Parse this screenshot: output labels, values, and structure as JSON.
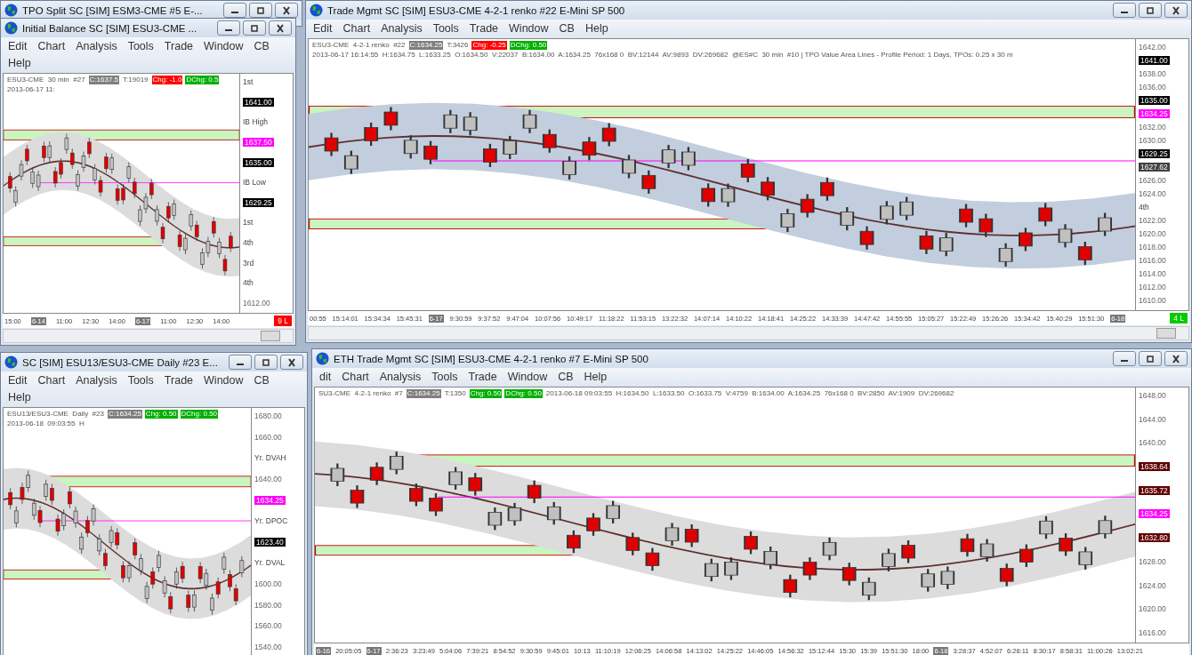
{
  "windows": [
    {
      "kind": "stub",
      "title": "TPO Split  SC [SIM] ESM3-CME  #5  E-..."
    },
    {
      "kind": "chart",
      "title": "Initial Balance  SC [SIM] ESU3-CME  ...",
      "menu": [
        "Edit",
        "Chart",
        "Analysis",
        "Tools",
        "Trade",
        "Window",
        "CB",
        "Help"
      ],
      "info": [
        {
          "text": "ESU3-CME  30 min  #27"
        },
        {
          "text": "C:1637.5",
          "color": "#7f7f7f"
        },
        {
          "text": "T:19019"
        },
        {
          "text": "Chg: -1.0",
          "color": "#ff0000"
        },
        {
          "text": "DChg: 0.5",
          "color": "#00b000"
        },
        {
          "text": "2013-06-17 11:"
        }
      ],
      "axis": [
        {
          "kind": "note",
          "text": "1st"
        },
        {
          "kind": "marker",
          "text": "1641.00",
          "color": "#000000"
        },
        {
          "kind": "note",
          "text": "IB High"
        },
        {
          "kind": "marker",
          "text": "1637.50",
          "color": "#ff00ff"
        },
        {
          "kind": "marker",
          "text": "1635.00",
          "color": "#000000"
        },
        {
          "kind": "note",
          "text": "IB Low"
        },
        {
          "kind": "marker",
          "text": "1629.25",
          "color": "#000000"
        },
        {
          "kind": "note",
          "text": "1st"
        },
        {
          "kind": "note",
          "text": "4th"
        },
        {
          "kind": "note",
          "text": "3rd"
        },
        {
          "kind": "note",
          "text": "4th"
        },
        {
          "kind": "tick",
          "text": "1612.00"
        }
      ],
      "times": [
        {
          "text": "15:00",
          "date": false
        },
        {
          "text": "6-14",
          "date": true
        },
        {
          "text": "11:00",
          "date": false
        },
        {
          "text": "12:30",
          "date": false
        },
        {
          "text": "14:00",
          "date": false
        },
        {
          "text": "6-17",
          "date": true
        },
        {
          "text": "11:00",
          "date": false
        },
        {
          "text": "12:30",
          "date": false
        },
        {
          "text": "14:00",
          "date": false
        }
      ],
      "status": {
        "text": "9 L",
        "color": "#ff0000"
      }
    },
    {
      "kind": "chart",
      "title": "Trade Mgmt  SC [SIM] ESU3-CME  4-2-1 renko  #22  E-Mini SP 500",
      "menu": [
        "Edit",
        "Chart",
        "Analysis",
        "Tools",
        "Trade",
        "Window",
        "CB",
        "Help"
      ],
      "info": [
        {
          "text": "ESU3-CME  4-2-1 renko  #22"
        },
        {
          "text": "C:1634.25",
          "color": "#7f7f7f"
        },
        {
          "text": "T:3426"
        },
        {
          "text": "Chg: -0.25",
          "color": "#ff0000"
        },
        {
          "text": "DChg: 0.50",
          "color": "#00b000"
        },
        {
          "text": "2013-06-17 16:14:55  H:1634.75  L:1633.25  O:1634.50  V:22037  B:1634.00  A:1634.25  76x168 0  BV:12144  AV:9893  DV:269682  @ES#C  30 min  #10 | TPO Value Area Lines - Profile Period: 1 Days, TPOs: 0.25 x 30 m"
        }
      ],
      "axis": [
        {
          "kind": "tick",
          "text": "1642.00"
        },
        {
          "kind": "marker",
          "text": "1641.00",
          "color": "#000000"
        },
        {
          "kind": "tick",
          "text": "1638.00"
        },
        {
          "kind": "tick",
          "text": "1636.00"
        },
        {
          "kind": "marker",
          "text": "1635.00",
          "color": "#000000"
        },
        {
          "kind": "marker",
          "text": "1634.25",
          "color": "#ff00ff"
        },
        {
          "kind": "tick",
          "text": "1632.00"
        },
        {
          "kind": "tick",
          "text": "1630.00"
        },
        {
          "kind": "marker",
          "text": "1629.25",
          "color": "#000000"
        },
        {
          "kind": "marker",
          "text": "1627.62",
          "color": "#404040"
        },
        {
          "kind": "tick",
          "text": "1626.00"
        },
        {
          "kind": "tick",
          "text": "1624.00"
        },
        {
          "kind": "note",
          "text": "4th"
        },
        {
          "kind": "tick",
          "text": "1622.00"
        },
        {
          "kind": "tick",
          "text": "1620.00"
        },
        {
          "kind": "tick",
          "text": "1618.00"
        },
        {
          "kind": "tick",
          "text": "1616.00"
        },
        {
          "kind": "tick",
          "text": "1614.00"
        },
        {
          "kind": "tick",
          "text": "1612.00"
        },
        {
          "kind": "tick",
          "text": "1610.00"
        }
      ],
      "times": [
        {
          "text": "00:55",
          "date": false
        },
        {
          "text": "15:14:01",
          "date": false
        },
        {
          "text": "15:34:34",
          "date": false
        },
        {
          "text": "15:45:31",
          "date": false
        },
        {
          "text": "6-17",
          "date": true
        },
        {
          "text": "9:30:59",
          "date": false
        },
        {
          "text": "9:37:52",
          "date": false
        },
        {
          "text": "9:47:04",
          "date": false
        },
        {
          "text": "10:07:56",
          "date": false
        },
        {
          "text": "10:49:17",
          "date": false
        },
        {
          "text": "11:18:22",
          "date": false
        },
        {
          "text": "11:53:15",
          "date": false
        },
        {
          "text": "13:22:32",
          "date": false
        },
        {
          "text": "14:07:14",
          "date": false
        },
        {
          "text": "14:10:22",
          "date": false
        },
        {
          "text": "14:18:41",
          "date": false
        },
        {
          "text": "14:25:22",
          "date": false
        },
        {
          "text": "14:33:39",
          "date": false
        },
        {
          "text": "14:47:42",
          "date": false
        },
        {
          "text": "14:55:55",
          "date": false
        },
        {
          "text": "15:05:27",
          "date": false
        },
        {
          "text": "15:22:49",
          "date": false
        },
        {
          "text": "15:26:26",
          "date": false
        },
        {
          "text": "15:34:42",
          "date": false
        },
        {
          "text": "15:40:29",
          "date": false
        },
        {
          "text": "15:51:30",
          "date": false
        },
        {
          "text": "6-18",
          "date": true
        }
      ],
      "status": {
        "text": "4 L",
        "color": "#00cc00"
      }
    },
    {
      "kind": "chart",
      "title": "SC [SIM] ESU13/ESU3-CME  Daily  #23  E...",
      "menu": [
        "Edit",
        "Chart",
        "Analysis",
        "Tools",
        "Trade",
        "Window",
        "CB",
        "Help"
      ],
      "info": [
        {
          "text": "ESU13/ESU3-CME  Daily  #23"
        },
        {
          "text": "C:1634.25",
          "color": "#7f7f7f"
        },
        {
          "text": "Chg: 0.50",
          "color": "#00b000"
        },
        {
          "text": "DChg: 0.50",
          "color": "#00b000"
        },
        {
          "text": "2013-06-18  09:03:55  H"
        }
      ],
      "axis": [
        {
          "kind": "tick",
          "text": "1680.00"
        },
        {
          "kind": "tick",
          "text": "1660.00"
        },
        {
          "kind": "note",
          "text": "Yr. DVAH"
        },
        {
          "kind": "tick",
          "text": "1640.00"
        },
        {
          "kind": "marker",
          "text": "1634.25",
          "color": "#ff00ff"
        },
        {
          "kind": "note",
          "text": "Yr. DPOC"
        },
        {
          "kind": "marker",
          "text": "1623.40",
          "color": "#000000"
        },
        {
          "kind": "note",
          "text": "Yr. DVAL"
        },
        {
          "kind": "tick",
          "text": "1600.00"
        },
        {
          "kind": "tick",
          "text": "1580.00"
        },
        {
          "kind": "tick",
          "text": "1560.00"
        },
        {
          "kind": "tick",
          "text": "1540.00"
        }
      ]
    },
    {
      "kind": "chart",
      "title": "ETH Trade Mgmt  SC [SIM] ESU3-CME  4-2-1 renko  #7  E-Mini SP 500",
      "menu": [
        "dit",
        "Chart",
        "Analysis",
        "Tools",
        "Trade",
        "Window",
        "CB",
        "Help"
      ],
      "info": [
        {
          "text": "SU3-CME  4-2-1 renko  #7"
        },
        {
          "text": "C:1634.25",
          "color": "#7f7f7f"
        },
        {
          "text": "T:1350"
        },
        {
          "text": "Chg: 0.50",
          "color": "#00b000"
        },
        {
          "text": "DChg: 0.50",
          "color": "#00b000"
        },
        {
          "text": "2013-06-18 09:03:55  H:1634.50  L:1633.50  O:1633.75  V:4759  B:1634.00  A:1634.25  76x168 0  BV:2850  AV:1909  DV:269682"
        }
      ],
      "axis": [
        {
          "kind": "tick",
          "text": "1648.00"
        },
        {
          "kind": "tick",
          "text": "1644.00"
        },
        {
          "kind": "tick",
          "text": "1640.00"
        },
        {
          "kind": "marker",
          "text": "1638.64",
          "color": "#600000"
        },
        {
          "kind": "marker",
          "text": "1635.72",
          "color": "#600000"
        },
        {
          "kind": "marker",
          "text": "1634.25",
          "color": "#ff00ff"
        },
        {
          "kind": "marker",
          "text": "1632.80",
          "color": "#600000"
        },
        {
          "kind": "tick",
          "text": "1628.00"
        },
        {
          "kind": "tick",
          "text": "1624.00"
        },
        {
          "kind": "tick",
          "text": "1620.00"
        },
        {
          "kind": "tick",
          "text": "1616.00"
        }
      ],
      "times": [
        {
          "text": "6-16",
          "date": true
        },
        {
          "text": "20:05:05",
          "date": false
        },
        {
          "text": "6-17",
          "date": true
        },
        {
          "text": "2:36:23",
          "date": false
        },
        {
          "text": "3:23:49",
          "date": false
        },
        {
          "text": "5:04:06",
          "date": false
        },
        {
          "text": "7:39:21",
          "date": false
        },
        {
          "text": "8:54:52",
          "date": false
        },
        {
          "text": "9:30:59",
          "date": false
        },
        {
          "text": "9:45:01",
          "date": false
        },
        {
          "text": "10:13",
          "date": false
        },
        {
          "text": "11:10:19",
          "date": false
        },
        {
          "text": "12:06:25",
          "date": false
        },
        {
          "text": "14:06:58",
          "date": false
        },
        {
          "text": "14:13:02",
          "date": false
        },
        {
          "text": "14:25:22",
          "date": false
        },
        {
          "text": "14:46:05",
          "date": false
        },
        {
          "text": "14:56:32",
          "date": false
        },
        {
          "text": "15:12:44",
          "date": false
        },
        {
          "text": "15:30",
          "date": false
        },
        {
          "text": "15:39",
          "date": false
        },
        {
          "text": "15:51:30",
          "date": false
        },
        {
          "text": "18:00",
          "date": false
        },
        {
          "text": "6-18",
          "date": true
        },
        {
          "text": "3:28:37",
          "date": false
        },
        {
          "text": "4:52:07",
          "date": false
        },
        {
          "text": "6:26:11",
          "date": false
        },
        {
          "text": "8:30:17",
          "date": false
        },
        {
          "text": "8:58:31",
          "date": false
        },
        {
          "text": "11:00:26",
          "date": false
        },
        {
          "text": "13:02:21",
          "date": false
        }
      ]
    }
  ]
}
